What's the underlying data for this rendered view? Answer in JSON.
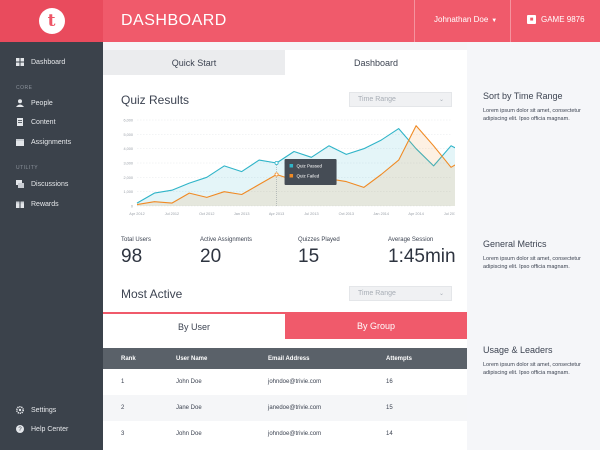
{
  "app": {
    "logo_letter": "t",
    "title": "DASHBOARD"
  },
  "header": {
    "user": "Johnathan Doe",
    "game": "GAME 9876"
  },
  "sidebar": {
    "top_items": [
      {
        "label": "Dashboard",
        "icon": "dashboard-icon"
      }
    ],
    "core_label": "CORE",
    "core_items": [
      {
        "label": "People",
        "icon": "people-icon"
      },
      {
        "label": "Content",
        "icon": "content-icon"
      },
      {
        "label": "Assignments",
        "icon": "assignments-icon"
      }
    ],
    "utility_label": "UTILITY",
    "utility_items": [
      {
        "label": "Discussions",
        "icon": "discussions-icon"
      },
      {
        "label": "Rewards",
        "icon": "rewards-icon"
      }
    ],
    "bottom_items": [
      {
        "label": "Settings",
        "icon": "gear-icon"
      },
      {
        "label": "Help Center",
        "icon": "help-icon"
      }
    ]
  },
  "main": {
    "tabs": [
      {
        "label": "Quick Start"
      },
      {
        "label": "Dashboard"
      }
    ],
    "quiz_title": "Quiz Results",
    "time_range_placeholder": "Time Range",
    "stats": [
      {
        "label": "Total Users",
        "value": "98"
      },
      {
        "label": "Active Assignments",
        "value": "20"
      },
      {
        "label": "Quizzes Played",
        "value": "15"
      },
      {
        "label": "Average Session",
        "value": "1:45min"
      }
    ],
    "most_active_title": "Most Active",
    "group_tabs": [
      {
        "label": "By User"
      },
      {
        "label": "By Group"
      }
    ],
    "table": {
      "headers": [
        "Rank",
        "User Name",
        "Email Address",
        "Attempts"
      ],
      "rows": [
        [
          "1",
          "John Doe",
          "johndoe@trivie.com",
          "16"
        ],
        [
          "2",
          "Jane Doe",
          "janedoe@trivie.com",
          "15"
        ],
        [
          "3",
          "John Doe",
          "johndoe@trivie.com",
          "14"
        ]
      ]
    }
  },
  "right_panel": {
    "sections": [
      {
        "title": "Sort by Time Range",
        "text": "Lorem ipsum dolor sit amet, consectetur adipiscing elit. Ipso officia magnam."
      },
      {
        "title": "General Metrics",
        "text": "Lorem ipsum dolor sit amet, consectetur adipiscing elit. Ipso officia magnam."
      },
      {
        "title": "Usage & Leaders",
        "text": "Lorem ipsum dolor sit amet, consectetur adipiscing elit. Ipso officia magnam."
      }
    ]
  },
  "colors": {
    "accent": "#f05a6b",
    "sidebar": "#3b424b",
    "passed": "#2fb4c8",
    "failed": "#f08a24"
  },
  "chart_data": {
    "type": "area",
    "title": "Quiz Results",
    "xlabel": "",
    "ylabel": "",
    "y_ticks": [
      "0",
      "1,000",
      "2,000",
      "3,000",
      "4,000",
      "5,000",
      "6,000"
    ],
    "ylim": [
      0,
      6000
    ],
    "x_ticks": [
      "Apr 2012",
      "Jul 2012",
      "Oct 2012",
      "Jan 2013",
      "Apr 2013",
      "Jul 2013",
      "Oct 2013",
      "Jan 2014",
      "Apr 2014",
      "Jul 2014"
    ],
    "x": [
      0,
      0.5,
      1,
      1.5,
      2,
      2.5,
      3,
      3.5,
      4,
      4.5,
      5,
      5.5,
      6,
      6.5,
      7,
      7.5,
      8,
      8.5,
      9,
      9.5,
      10
    ],
    "series": [
      {
        "name": "Quiz Passed",
        "values": [
          200,
          900,
          1100,
          1600,
          2000,
          2800,
          2400,
          3200,
          3000,
          3800,
          3400,
          4200,
          3600,
          4000,
          4600,
          5400,
          4000,
          2800,
          4200,
          3600,
          5000
        ]
      },
      {
        "name": "Quiz Failed",
        "values": [
          100,
          300,
          200,
          900,
          600,
          1000,
          800,
          1500,
          2200,
          1800,
          1500,
          1900,
          1700,
          1300,
          2200,
          3200,
          5600,
          4200,
          2700,
          3400,
          4400
        ]
      }
    ],
    "tooltip": {
      "x_index": 8,
      "items": [
        "Quiz Passed",
        "Quiz Failed"
      ]
    },
    "grid": true
  }
}
